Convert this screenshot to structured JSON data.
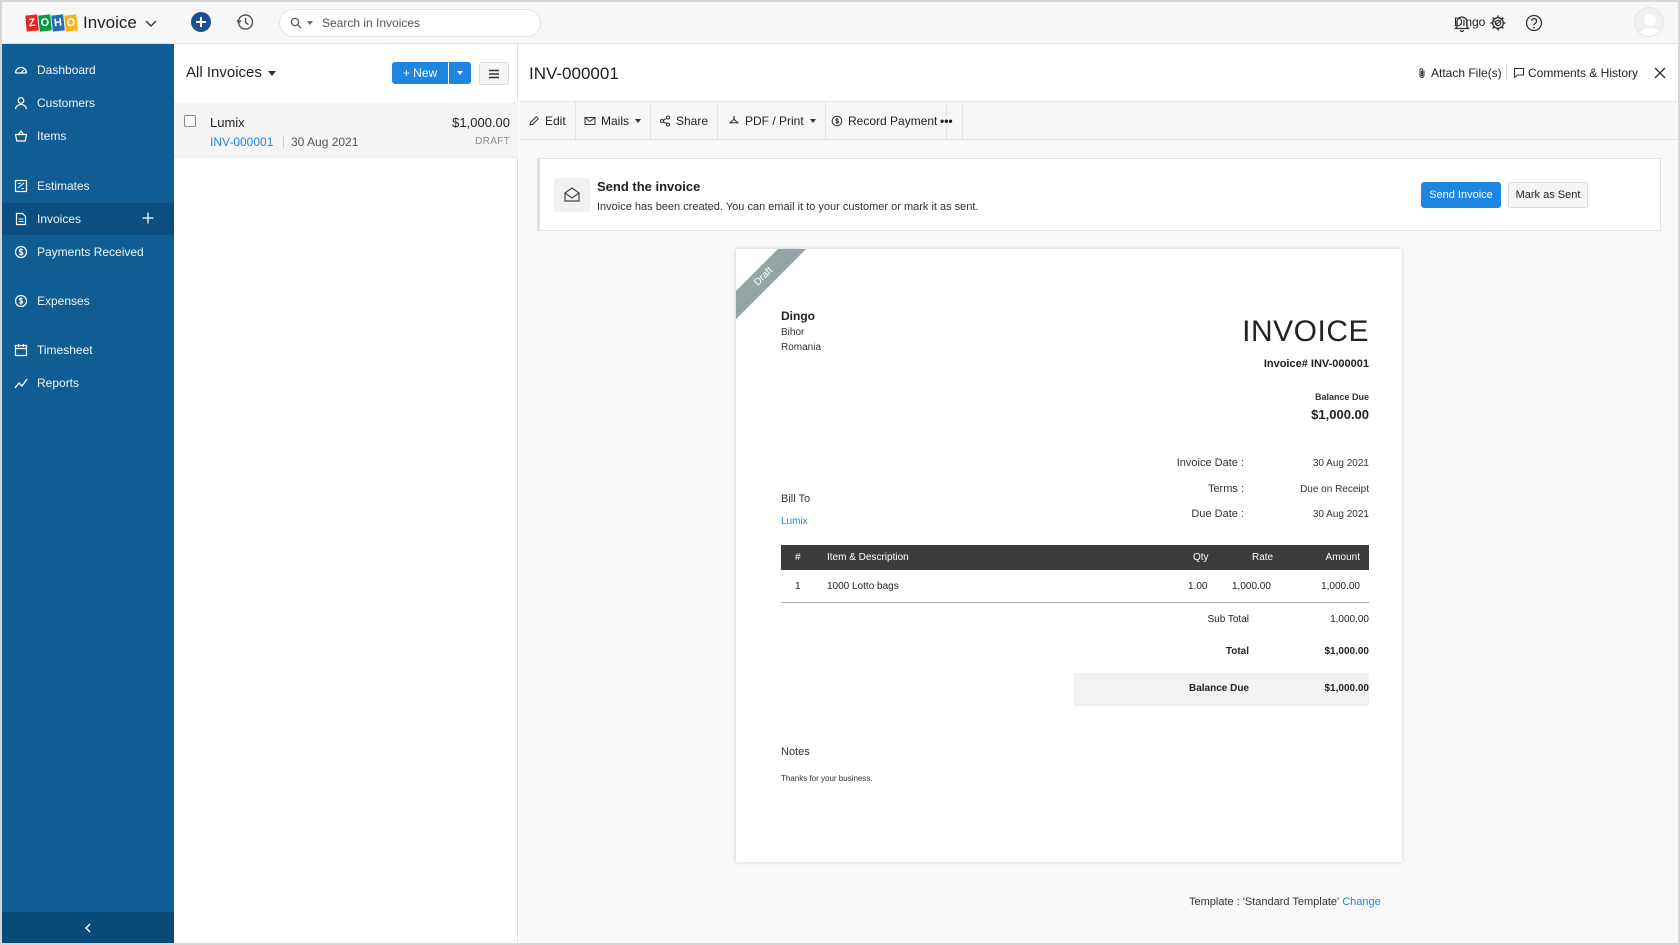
{
  "topbar": {
    "logo_letters": [
      "Z",
      "O",
      "H",
      "O"
    ],
    "logo_colors": [
      "#e42527",
      "#089949",
      "#226db4",
      "#f9b21d"
    ],
    "app_name": "Invoice",
    "search_placeholder": "Search in Invoices",
    "user_name": "Dingo"
  },
  "sidebar": {
    "items": [
      {
        "label": "Dashboard",
        "icon": "dashboard-icon"
      },
      {
        "label": "Customers",
        "icon": "user-icon"
      },
      {
        "label": "Items",
        "icon": "basket-icon"
      },
      {
        "label": "Estimates",
        "icon": "estimate-icon"
      },
      {
        "label": "Invoices",
        "icon": "invoice-icon",
        "active": true
      },
      {
        "label": "Payments Received",
        "icon": "payment-icon"
      },
      {
        "label": "Expenses",
        "icon": "expense-icon"
      },
      {
        "label": "Timesheet",
        "icon": "calendar-icon"
      },
      {
        "label": "Reports",
        "icon": "chart-icon"
      }
    ]
  },
  "list": {
    "view_title": "All Invoices",
    "new_label": "+ New",
    "rows": [
      {
        "customer": "Lumix",
        "amount": "$1,000.00",
        "number": "INV-000001",
        "date": "30 Aug 2021",
        "status": "DRAFT"
      }
    ]
  },
  "detail": {
    "title": "INV-000001",
    "attach_label": "Attach File(s)",
    "comments_label": "Comments & History",
    "toolbar": {
      "edit": "Edit",
      "mails": "Mails",
      "share": "Share",
      "pdf": "PDF / Print",
      "record": "Record Payment",
      "more": "•••"
    },
    "send_card": {
      "title": "Send the invoice",
      "description": "Invoice has been created. You can email it to your customer or mark it as sent.",
      "send_button": "Send Invoice",
      "mark_button": "Mark as Sent"
    },
    "invoice": {
      "ribbon": "Draft",
      "org_name": "Dingo",
      "org_address": [
        "Bihor",
        "Romania"
      ],
      "heading": "INVOICE",
      "number_line": "Invoice# INV-000001",
      "balance_label": "Balance Due",
      "balance_value": "$1,000.00",
      "meta": [
        {
          "label": "Invoice Date :",
          "value": "30 Aug 2021"
        },
        {
          "label": "Terms :",
          "value": "Due on Receipt"
        },
        {
          "label": "Due Date :",
          "value": "30 Aug 2021"
        }
      ],
      "bill_to_label": "Bill To",
      "bill_to_name": "Lumix",
      "columns": {
        "num": "#",
        "item": "Item & Description",
        "qty": "Qty",
        "rate": "Rate",
        "amount": "Amount"
      },
      "items": [
        {
          "num": "1",
          "item": "1000 Lotto bags",
          "qty": "1.00",
          "rate": "1,000.00",
          "amount": "1,000.00"
        }
      ],
      "subtotal_label": "Sub Total",
      "subtotal_value": "1,000.00",
      "total_label": "Total",
      "total_value": "$1,000.00",
      "balance_due_label": "Balance Due",
      "balance_due_value": "$1,000.00",
      "notes_label": "Notes",
      "notes_text": "Thanks for your business."
    },
    "template_label": "Template : 'Standard Template'",
    "template_change": "Change"
  }
}
